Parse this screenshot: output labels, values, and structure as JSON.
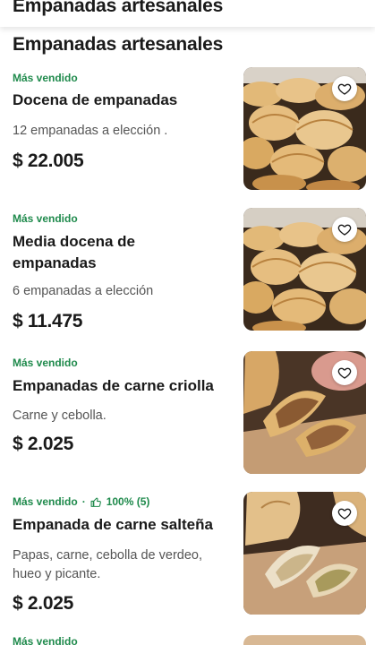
{
  "header": {
    "title": "Empanadas artesanales"
  },
  "section": {
    "title": "Empanadas artesanales"
  },
  "products": [
    {
      "badge": "Más vendido",
      "name": "Docena de empanadas",
      "description": "12 empanadas a elección .",
      "price": "$ 22.005",
      "image": "empanadas-tray"
    },
    {
      "badge": "Más vendido",
      "name": "Media docena de empanadas",
      "description": "6 empanadas a elección",
      "price": "$ 11.475",
      "image": "empanadas-tray"
    },
    {
      "badge": "Más vendido",
      "name": "Empanadas de carne criolla",
      "description": "Carne y cebolla.",
      "price": "$ 2.025",
      "image": "empanada-cut"
    },
    {
      "badge": "Más vendido",
      "rating_separator": "·",
      "rating": "100% (5)",
      "name": "Empanada de carne salteña",
      "description": "Papas, carne, cebolla de verdeo, hueo y picante.",
      "price": "$ 2.025",
      "image": "empanada-cut"
    },
    {
      "badge": "Más vendido"
    }
  ],
  "colors": {
    "badge_green": "#1f8a4c",
    "text": "#1a1a1a",
    "muted": "#555555"
  },
  "icons": {
    "favorite": "heart-icon",
    "rating": "thumbs-up-icon"
  }
}
